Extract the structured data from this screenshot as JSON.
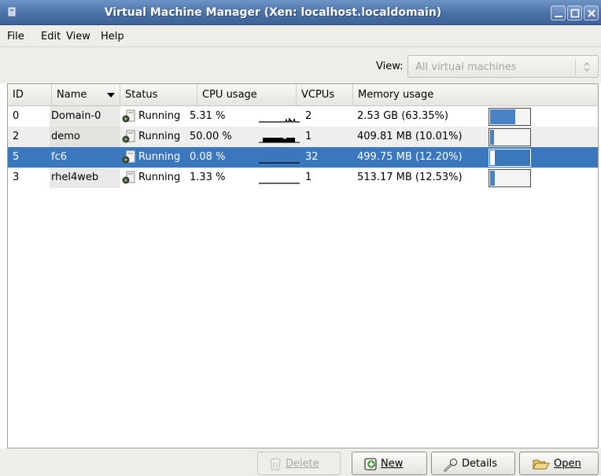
{
  "window": {
    "title": "Virtual Machine Manager (Xen: localhost.localdomain)",
    "colors": {
      "titlebar": "#4a71a8",
      "selection": "#3b77bc",
      "memory_fill": "#4a83c5"
    }
  },
  "menu": {
    "file": "File",
    "edit": "Edit",
    "view": "View",
    "help": "Help"
  },
  "filter": {
    "label": "View:",
    "selected": "All virtual machines"
  },
  "table": {
    "columns": {
      "id": "ID",
      "name": "Name",
      "status": "Status",
      "cpu": "CPU usage",
      "vcpus": "VCPUs",
      "memory": "Memory usage"
    },
    "rows": [
      {
        "id": "0",
        "name": "Domain-0",
        "status": "Running",
        "cpu": "5.31 %",
        "vcpus": "2",
        "memory": "2.53 GB (63.35%)",
        "memory_fraction": 0.6335,
        "selected": false
      },
      {
        "id": "2",
        "name": "demo",
        "status": "Running",
        "cpu": "50.00 %",
        "vcpus": "1",
        "memory": "409.81 MB (10.01%)",
        "memory_fraction": 0.1001,
        "selected": false
      },
      {
        "id": "5",
        "name": "fc6",
        "status": "Running",
        "cpu": "0.08 %",
        "vcpus": "32",
        "memory": "499.75 MB (12.20%)",
        "memory_fraction": 0.122,
        "selected": true
      },
      {
        "id": "3",
        "name": "rhel4web",
        "status": "Running",
        "cpu": "1.33 %",
        "vcpus": "1",
        "memory": "513.17 MB (12.53%)",
        "memory_fraction": 0.1253,
        "selected": false
      }
    ]
  },
  "buttons": {
    "delete": "Delete",
    "new": "New",
    "details": "Details",
    "open": "Open"
  },
  "icons": {
    "status": "running-icon",
    "delete": "trash-icon",
    "new": "add-icon",
    "details": "wrench-icon",
    "open": "folder-open-icon"
  }
}
